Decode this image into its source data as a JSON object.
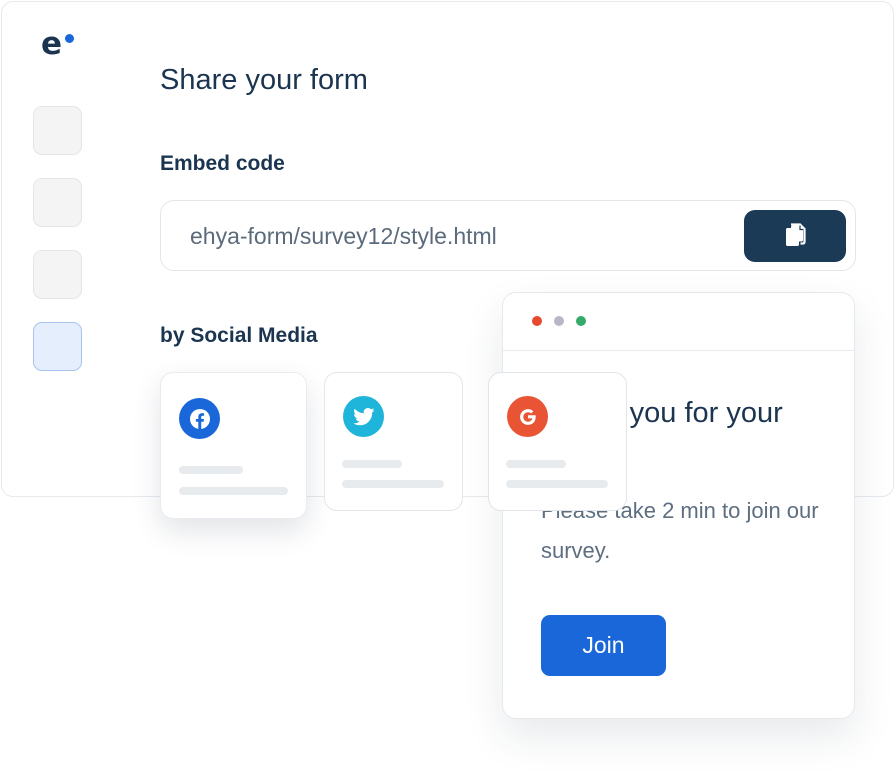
{
  "brand": {
    "logo_letter": "e",
    "accent_color": "#1967d8",
    "dark_color": "#1b3550"
  },
  "sidebar": {
    "items": [
      {
        "state": "default"
      },
      {
        "state": "default"
      },
      {
        "state": "default"
      },
      {
        "state": "active"
      }
    ]
  },
  "share": {
    "title": "Share your form",
    "embed_label": "Embed code",
    "embed_value": "ehya-form/survey12/style.html",
    "copy_icon": "copy-icon",
    "social_label": "by Social Media"
  },
  "social_cards": [
    {
      "network": "facebook",
      "icon": "facebook-icon",
      "color": "#1967d8"
    },
    {
      "network": "twitter",
      "icon": "twitter-icon",
      "color": "#1fb4d9"
    },
    {
      "network": "google",
      "icon": "google-icon",
      "color": "#e85434"
    }
  ],
  "popup": {
    "window_dots": [
      "#e6492d",
      "#b9b6c8",
      "#34aa6b"
    ],
    "heading": "Thank you for your visit!",
    "body": "Please take 2 min to join our survey.",
    "button_label": "Join"
  }
}
